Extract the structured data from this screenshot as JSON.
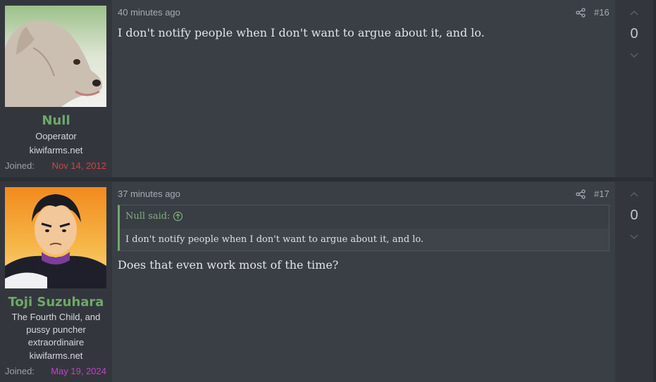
{
  "posts": [
    {
      "username": "Null",
      "user_title": "Ooperator",
      "site": "kiwifarms.net",
      "joined_label": "Joined:",
      "joined_date": "Nov 14, 2012",
      "joined_color": "#c9474a",
      "time": "40 minutes ago",
      "post_number": "#16",
      "body": "I don't notify people when I don't want to argue about it, and lo.",
      "votes": "0"
    },
    {
      "username": "Toji Suzuhara",
      "user_title": "The Fourth Child, and pussy puncher extraordinaire",
      "site": "kiwifarms.net",
      "joined_label": "Joined:",
      "joined_date": "May 19, 2024",
      "joined_color": "#c441c4",
      "time": "37 minutes ago",
      "post_number": "#17",
      "quote": {
        "attribution": "Null said:",
        "text": "I don't notify people when I don't want to argue about it, and lo."
      },
      "body": "Does that even work most of the time?",
      "votes": "0"
    }
  ],
  "colors": {
    "username": "#6fa86a",
    "main_bg": "#3a3e45",
    "side_bg": "#33373d"
  },
  "icons": [
    "share-icon",
    "arrow-up-circle-icon",
    "chevron-up-icon",
    "chevron-down-icon"
  ]
}
